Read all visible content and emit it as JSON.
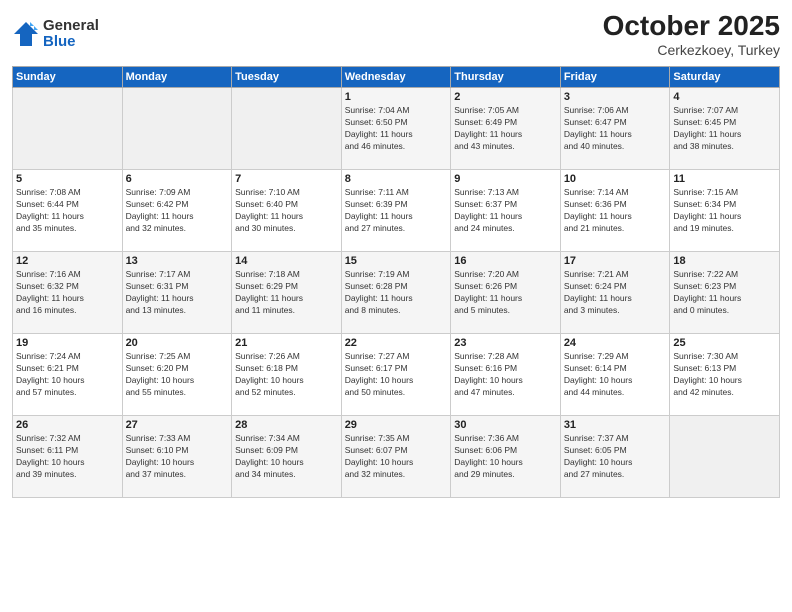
{
  "header": {
    "logo_general": "General",
    "logo_blue": "Blue",
    "month": "October 2025",
    "location": "Cerkezkoey, Turkey"
  },
  "days_of_week": [
    "Sunday",
    "Monday",
    "Tuesday",
    "Wednesday",
    "Thursday",
    "Friday",
    "Saturday"
  ],
  "weeks": [
    [
      {
        "day": "",
        "info": ""
      },
      {
        "day": "",
        "info": ""
      },
      {
        "day": "",
        "info": ""
      },
      {
        "day": "1",
        "info": "Sunrise: 7:04 AM\nSunset: 6:50 PM\nDaylight: 11 hours\nand 46 minutes."
      },
      {
        "day": "2",
        "info": "Sunrise: 7:05 AM\nSunset: 6:49 PM\nDaylight: 11 hours\nand 43 minutes."
      },
      {
        "day": "3",
        "info": "Sunrise: 7:06 AM\nSunset: 6:47 PM\nDaylight: 11 hours\nand 40 minutes."
      },
      {
        "day": "4",
        "info": "Sunrise: 7:07 AM\nSunset: 6:45 PM\nDaylight: 11 hours\nand 38 minutes."
      }
    ],
    [
      {
        "day": "5",
        "info": "Sunrise: 7:08 AM\nSunset: 6:44 PM\nDaylight: 11 hours\nand 35 minutes."
      },
      {
        "day": "6",
        "info": "Sunrise: 7:09 AM\nSunset: 6:42 PM\nDaylight: 11 hours\nand 32 minutes."
      },
      {
        "day": "7",
        "info": "Sunrise: 7:10 AM\nSunset: 6:40 PM\nDaylight: 11 hours\nand 30 minutes."
      },
      {
        "day": "8",
        "info": "Sunrise: 7:11 AM\nSunset: 6:39 PM\nDaylight: 11 hours\nand 27 minutes."
      },
      {
        "day": "9",
        "info": "Sunrise: 7:13 AM\nSunset: 6:37 PM\nDaylight: 11 hours\nand 24 minutes."
      },
      {
        "day": "10",
        "info": "Sunrise: 7:14 AM\nSunset: 6:36 PM\nDaylight: 11 hours\nand 21 minutes."
      },
      {
        "day": "11",
        "info": "Sunrise: 7:15 AM\nSunset: 6:34 PM\nDaylight: 11 hours\nand 19 minutes."
      }
    ],
    [
      {
        "day": "12",
        "info": "Sunrise: 7:16 AM\nSunset: 6:32 PM\nDaylight: 11 hours\nand 16 minutes."
      },
      {
        "day": "13",
        "info": "Sunrise: 7:17 AM\nSunset: 6:31 PM\nDaylight: 11 hours\nand 13 minutes."
      },
      {
        "day": "14",
        "info": "Sunrise: 7:18 AM\nSunset: 6:29 PM\nDaylight: 11 hours\nand 11 minutes."
      },
      {
        "day": "15",
        "info": "Sunrise: 7:19 AM\nSunset: 6:28 PM\nDaylight: 11 hours\nand 8 minutes."
      },
      {
        "day": "16",
        "info": "Sunrise: 7:20 AM\nSunset: 6:26 PM\nDaylight: 11 hours\nand 5 minutes."
      },
      {
        "day": "17",
        "info": "Sunrise: 7:21 AM\nSunset: 6:24 PM\nDaylight: 11 hours\nand 3 minutes."
      },
      {
        "day": "18",
        "info": "Sunrise: 7:22 AM\nSunset: 6:23 PM\nDaylight: 11 hours\nand 0 minutes."
      }
    ],
    [
      {
        "day": "19",
        "info": "Sunrise: 7:24 AM\nSunset: 6:21 PM\nDaylight: 10 hours\nand 57 minutes."
      },
      {
        "day": "20",
        "info": "Sunrise: 7:25 AM\nSunset: 6:20 PM\nDaylight: 10 hours\nand 55 minutes."
      },
      {
        "day": "21",
        "info": "Sunrise: 7:26 AM\nSunset: 6:18 PM\nDaylight: 10 hours\nand 52 minutes."
      },
      {
        "day": "22",
        "info": "Sunrise: 7:27 AM\nSunset: 6:17 PM\nDaylight: 10 hours\nand 50 minutes."
      },
      {
        "day": "23",
        "info": "Sunrise: 7:28 AM\nSunset: 6:16 PM\nDaylight: 10 hours\nand 47 minutes."
      },
      {
        "day": "24",
        "info": "Sunrise: 7:29 AM\nSunset: 6:14 PM\nDaylight: 10 hours\nand 44 minutes."
      },
      {
        "day": "25",
        "info": "Sunrise: 7:30 AM\nSunset: 6:13 PM\nDaylight: 10 hours\nand 42 minutes."
      }
    ],
    [
      {
        "day": "26",
        "info": "Sunrise: 7:32 AM\nSunset: 6:11 PM\nDaylight: 10 hours\nand 39 minutes."
      },
      {
        "day": "27",
        "info": "Sunrise: 7:33 AM\nSunset: 6:10 PM\nDaylight: 10 hours\nand 37 minutes."
      },
      {
        "day": "28",
        "info": "Sunrise: 7:34 AM\nSunset: 6:09 PM\nDaylight: 10 hours\nand 34 minutes."
      },
      {
        "day": "29",
        "info": "Sunrise: 7:35 AM\nSunset: 6:07 PM\nDaylight: 10 hours\nand 32 minutes."
      },
      {
        "day": "30",
        "info": "Sunrise: 7:36 AM\nSunset: 6:06 PM\nDaylight: 10 hours\nand 29 minutes."
      },
      {
        "day": "31",
        "info": "Sunrise: 7:37 AM\nSunset: 6:05 PM\nDaylight: 10 hours\nand 27 minutes."
      },
      {
        "day": "",
        "info": ""
      }
    ]
  ]
}
